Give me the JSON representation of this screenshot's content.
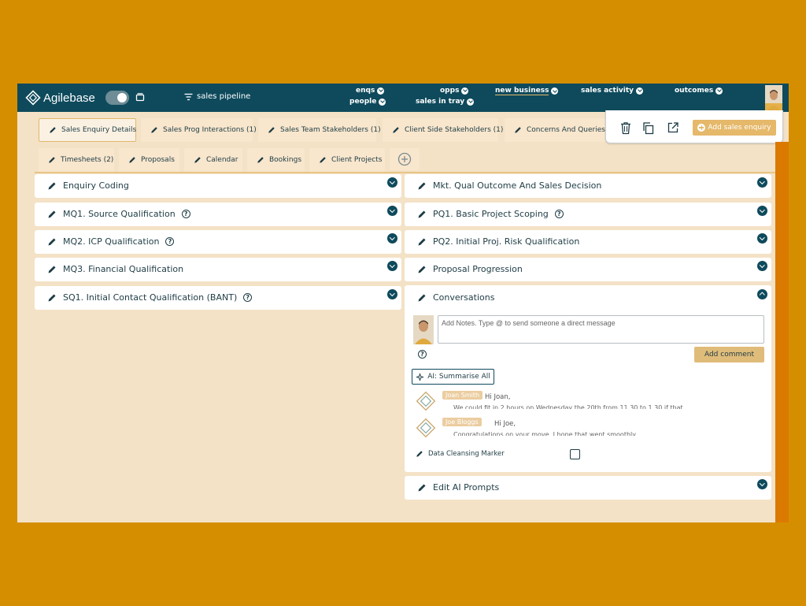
{
  "app": {
    "name": "Agilebase",
    "pipeline_label": "sales pipeline"
  },
  "nav": {
    "enqs": "enqs",
    "people": "people",
    "opps": "opps",
    "sales_in_tray": "sales in tray",
    "new_business": "new business",
    "sales_activity": "sales activity",
    "outcomes": "outcomes"
  },
  "tabs": {
    "row1": [
      "Sales Enquiry Details",
      "Sales Prog Interactions (1)",
      "Sales Team Stakeholders (1)",
      "Client Side Stakeholders (1)",
      "Concerns And Queries"
    ],
    "row2": [
      "Timesheets (2)",
      "Proposals",
      "Calendar",
      "Bookings",
      "Client Projects"
    ]
  },
  "actions": {
    "add_sales_enquiry": "Add sales enquiry"
  },
  "left_panels": [
    "Enquiry Coding",
    "MQ1. Source Qualification",
    "MQ2. ICP Qualification",
    "MQ3. Financial Qualification",
    "SQ1. Initial Contact Qualification (BANT)"
  ],
  "right_panels": [
    "Mkt. Qual Outcome And Sales Decision",
    "PQ1. Basic Project Scoping",
    "PQ2. Initial Proj. Risk Qualification",
    "Proposal Progression",
    "Conversations",
    "Edit AI Prompts"
  ],
  "conversations": {
    "notes_placeholder": "Add Notes. Type @ to send someone a direct message",
    "add_comment": "Add comment",
    "ai_summarise": "AI: Summarise All",
    "messages": [
      {
        "name": "Joan Smith",
        "greeting": "Hi Joan,",
        "body": "We could fit in 2 hours on Wednesday the 20th from 11.30 to 1.30 if that"
      },
      {
        "name": "Joe Bloggs",
        "greeting": "Hi Joe,",
        "body": "Congratulations on your move, I hope that went smoothly"
      }
    ],
    "data_cleansing_marker": "Data Cleansing Marker"
  },
  "colors": {
    "background": "#D58E00",
    "app_background": "#F4E2C7",
    "topbar": "#0E4A5C",
    "accent": "#E5B86A"
  }
}
